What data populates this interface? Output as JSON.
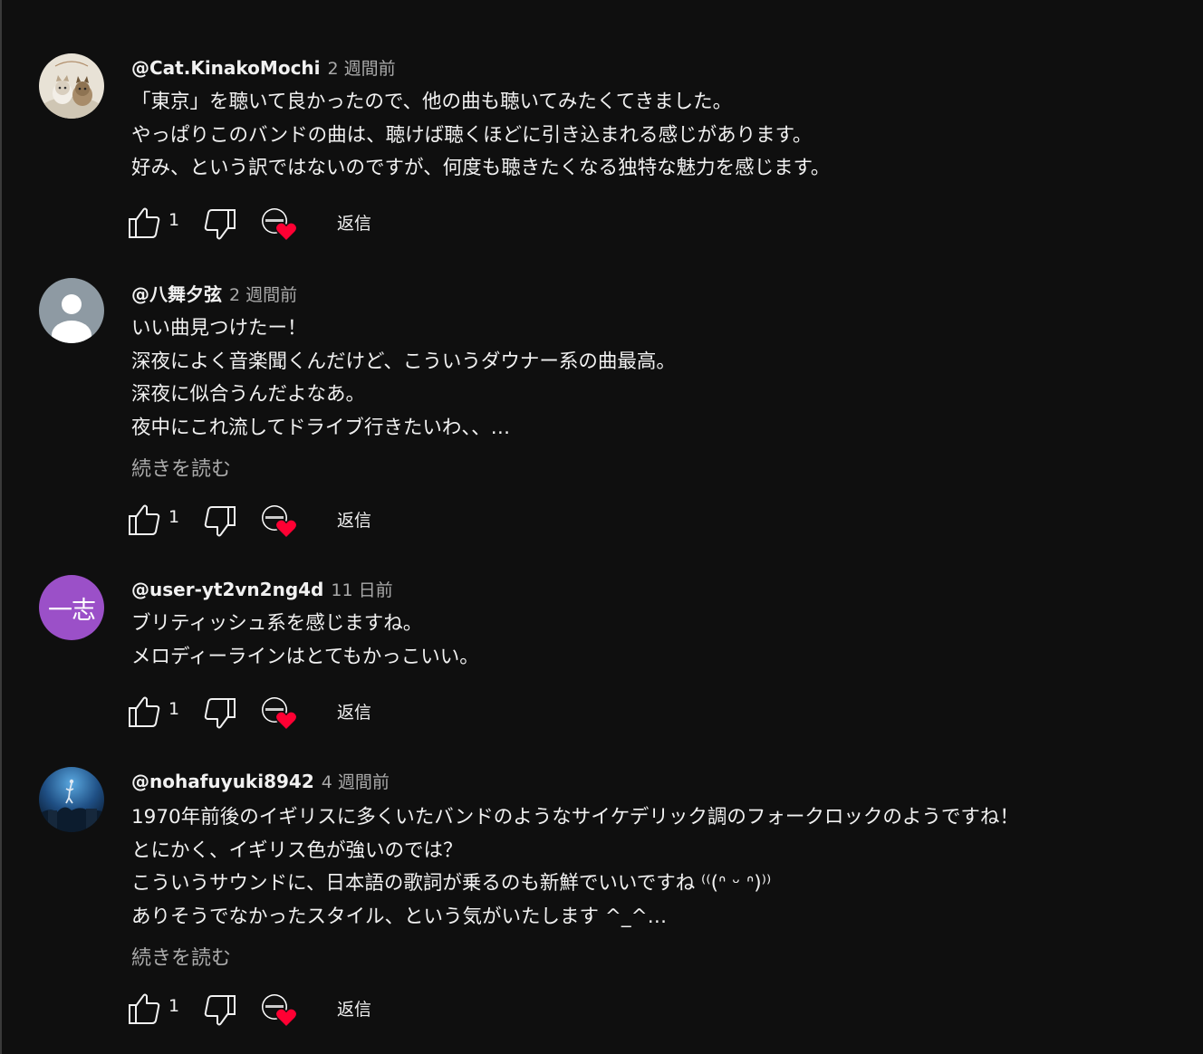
{
  "comments": [
    {
      "author": "@Cat.KinakoMochi",
      "time": "2 週間前",
      "lines": [
        "「東京」を聴いて良かったので、他の曲も聴いてみたくてきました。",
        "やっぱりこのバンドの曲は、聴けば聴くほどに引き込まれる感じがあります。",
        "好み、という訳ではないのですが、何度も聴きたくなる独特な魅力を感じます。"
      ],
      "read_more": "",
      "like_count": "1",
      "reply_label": "返信",
      "avatar_icon": "cats-photo-avatar"
    },
    {
      "author": "@八舞夕弦",
      "time": "2 週間前",
      "lines": [
        "いい曲見つけたー！",
        "深夜によく音楽聞くんだけど、こういうダウナー系の曲最高。",
        "深夜に似合うんだよなあ。",
        "夜中にこれ流してドライブ行きたいわ、、…"
      ],
      "read_more": "続きを読む",
      "like_count": "1",
      "reply_label": "返信",
      "avatar_icon": "default-person-avatar"
    },
    {
      "author": "@user-yt2vn2ng4d",
      "time": "11 日前",
      "lines": [
        "ブリティッシュ系を感じますね。",
        "メロディーラインはとてもかっこいい。"
      ],
      "read_more": "",
      "like_count": "1",
      "reply_label": "返信",
      "avatar_text": "一志",
      "avatar_color": "#9b50c8"
    },
    {
      "author": "@nohafuyuki8942",
      "time": "4 週間前",
      "lines": [
        "1970年前後のイギリスに多くいたバンドのようなサイケデリック調のフォークロックのようですね！",
        "とにかく、イギリス色が強いのでは？",
        "こういうサウンドに、日本語の歌詞が乗るのも新鮮でいいですね ⁽⁽(ᐢ ᵕ ᐢ)⁾⁾",
        "ありそうでなかったスタイル、という気がいたします ^_^…"
      ],
      "read_more": "続きを読む",
      "like_count": "1",
      "reply_label": "返信",
      "avatar_icon": "night-sky-photo-avatar"
    }
  ],
  "icons": {
    "like": "thumbs-up-icon",
    "dislike": "thumbs-down-icon",
    "creator_heart": "creator-heart-icon",
    "heart_color": "#ff0033"
  }
}
